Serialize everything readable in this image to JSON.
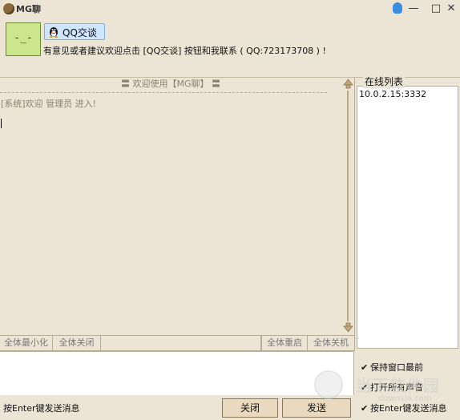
{
  "window": {
    "title": "MG聊",
    "controls": {
      "minimize": "—",
      "maximize": "□",
      "close": "✕"
    }
  },
  "header": {
    "avatar_face": "-_-",
    "qq_button_label": "QQ交谈",
    "notice": "有意见或者建议欢迎点击 [QQ交谈] 按钮和我联系 ( QQ:723173708 ) !"
  },
  "chat": {
    "welcome_banner": "〓 欢迎使用【MG聊】 〓",
    "messages": [
      "[系统]欢迎 管理员 进入!"
    ]
  },
  "actions": {
    "minimize_all": "全体最小化",
    "close_all": "全体关闭",
    "restart_all": "全体重启",
    "shutdown_all": "全体关机"
  },
  "footer": {
    "hint": "按Enter键发送消息",
    "close_button": "关闭",
    "send_button": "发送"
  },
  "online": {
    "title": "在线列表",
    "users": [
      "10.0.2.15:3332"
    ]
  },
  "options": [
    {
      "label": "保持窗口最前",
      "checked": true
    },
    {
      "label": "打开所有声音",
      "checked": true
    },
    {
      "label": "按Enter键发送消息",
      "checked": true
    }
  ],
  "watermark": {
    "cn": "当下软件园",
    "en": "downxia.com"
  },
  "colors": {
    "background": "#ece5d6",
    "avatar": "#cbe68c",
    "qq_button": "#cfe6ff",
    "button": "#e9d9bf"
  }
}
